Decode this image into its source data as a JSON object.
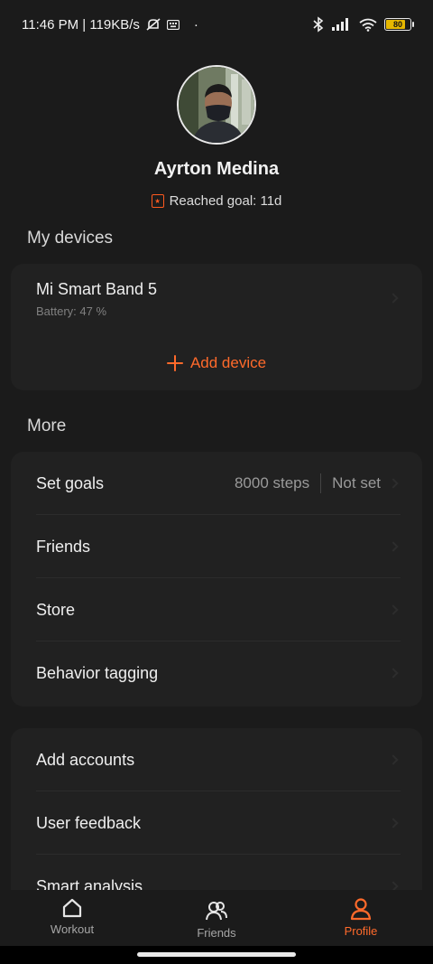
{
  "status_bar": {
    "time_speed": "11:46 PM | 119KB/s",
    "dot": "·",
    "battery_level": "80",
    "battery_fraction": 0.8
  },
  "profile": {
    "name": "Ayrton Medina",
    "goal_text": "Reached goal: 11d"
  },
  "devices": {
    "section_title": "My devices",
    "items": [
      {
        "name": "Mi Smart Band 5",
        "battery": "Battery: 47 %"
      }
    ],
    "add_label": "Add device"
  },
  "more": {
    "section_title": "More",
    "set_goals": {
      "label": "Set goals",
      "steps": "8000 steps",
      "weight": "Not set"
    },
    "friends": "Friends",
    "store": "Store",
    "behavior": "Behavior tagging"
  },
  "extra": {
    "add_accounts": "Add accounts",
    "user_feedback": "User feedback",
    "smart_analysis": "Smart analysis"
  },
  "nav": {
    "workout": "Workout",
    "friends": "Friends",
    "profile": "Profile"
  },
  "colors": {
    "accent": "#ff6a2b",
    "background": "#1b1b1b",
    "card": "#212121"
  }
}
